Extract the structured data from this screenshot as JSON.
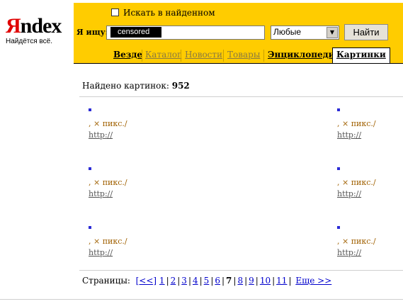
{
  "logo": {
    "ya": "Я",
    "ndex": "ndex",
    "slogan": "Найдётся всё."
  },
  "search": {
    "within_label": "Искать в найденном",
    "label": "Я ищу:",
    "value": "censored",
    "select_value": "Любые",
    "find_button": "Найти"
  },
  "tabs": [
    {
      "label": "Везде"
    },
    {
      "label": "Каталог"
    },
    {
      "label": "Новости"
    },
    {
      "label": "Товары"
    },
    {
      "label": "Энциклопедии"
    },
    {
      "label": "Картинки"
    }
  ],
  "results": {
    "found_label": "Найдено картинок:",
    "found_count": "952",
    "items": [
      {
        "size": ", × пикс./",
        "url": "http://"
      },
      {
        "size": ", × пикс./",
        "url": "http://"
      },
      {
        "size": ", × пикс./",
        "url": "http://"
      },
      {
        "size": ", × пикс./",
        "url": "http://"
      },
      {
        "size": ", × пикс./",
        "url": "http://"
      },
      {
        "size": ", × пикс./",
        "url": "http://"
      }
    ]
  },
  "pager": {
    "label": "Страницы:",
    "prev": "[<<]",
    "pages": [
      "1",
      "2",
      "3",
      "4",
      "5",
      "6",
      "7",
      "8",
      "9",
      "10",
      "11"
    ],
    "current": "7",
    "next": "Еще >>"
  },
  "colors": {
    "panel": "#ffcc00",
    "thumb": "#2b2bd6",
    "size_text": "#a06000",
    "link": "#0000cc"
  }
}
